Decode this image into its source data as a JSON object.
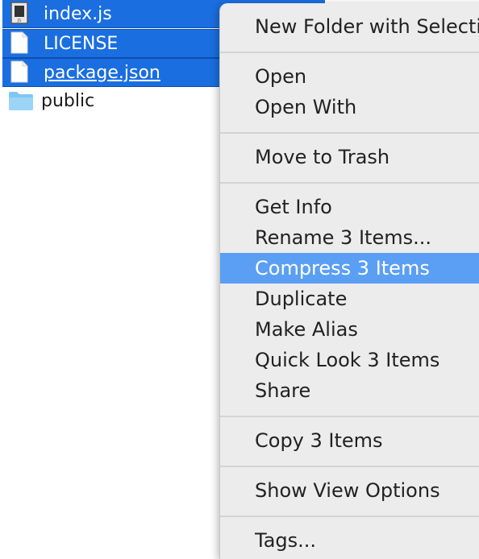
{
  "files": [
    {
      "name": "index.js",
      "kind": "js-file-icon",
      "selected": true
    },
    {
      "name": "LICENSE",
      "kind": "document-icon",
      "selected": true
    },
    {
      "name": "package.json",
      "kind": "document-icon",
      "selected": true
    },
    {
      "name": "public",
      "kind": "folder-icon",
      "selected": false
    }
  ],
  "colors": {
    "selection": "#1a6ee0",
    "menu_background": "#ececec",
    "menu_highlight": "#5a9ff3",
    "folder": "#7fc6f2"
  },
  "context_menu": {
    "items": [
      "New Folder with Selection",
      "Open",
      "Open With",
      "Move to Trash",
      "Get Info",
      "Rename 3 Items...",
      "Compress 3 Items",
      "Duplicate",
      "Make Alias",
      "Quick Look 3 Items",
      "Share",
      "Copy 3 Items",
      "Show View Options",
      "Tags..."
    ],
    "highlighted": "Compress 3 Items"
  }
}
